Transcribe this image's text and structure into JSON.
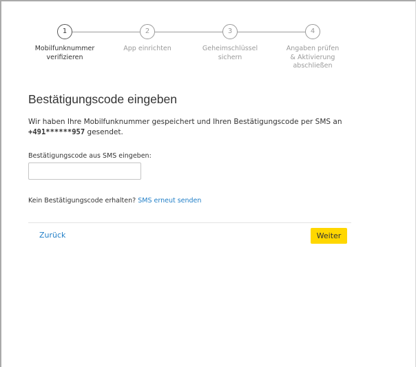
{
  "stepper": {
    "steps": [
      {
        "number": "1",
        "label_line1": "Mobilfunknummer",
        "label_line2": "verifizieren",
        "label_line3": "",
        "state": "active"
      },
      {
        "number": "2",
        "label_line1": "App einrichten",
        "label_line2": "",
        "label_line3": "",
        "state": "inactive"
      },
      {
        "number": "3",
        "label_line1": "Geheimschlüssel",
        "label_line2": "sichern",
        "label_line3": "",
        "state": "inactive"
      },
      {
        "number": "4",
        "label_line1": "Angaben prüfen",
        "label_line2": "& Aktivierung",
        "label_line3": "abschließen",
        "state": "inactive"
      }
    ]
  },
  "main": {
    "title": "Bestätigungscode eingeben",
    "intro_text": "Wir haben Ihre Mobilfunknummer gespeichert und Ihren Bestätigungscode per SMS an",
    "phone_number": "+491******957",
    "intro_suffix": " gesendet.",
    "code_field": {
      "label": "Bestätigungscode aus SMS eingeben:",
      "value": "",
      "placeholder": ""
    },
    "resend": {
      "question": "Kein Bestätigungscode erhalten?",
      "link_label": "SMS erneut senden"
    }
  },
  "footer": {
    "back_label": "Zurück",
    "next_label": "Weiter"
  },
  "colors": {
    "accent_yellow": "#ffd700",
    "link_blue": "#1f7ec7",
    "text_dark": "#333333",
    "text_muted": "#9a9a9a"
  }
}
